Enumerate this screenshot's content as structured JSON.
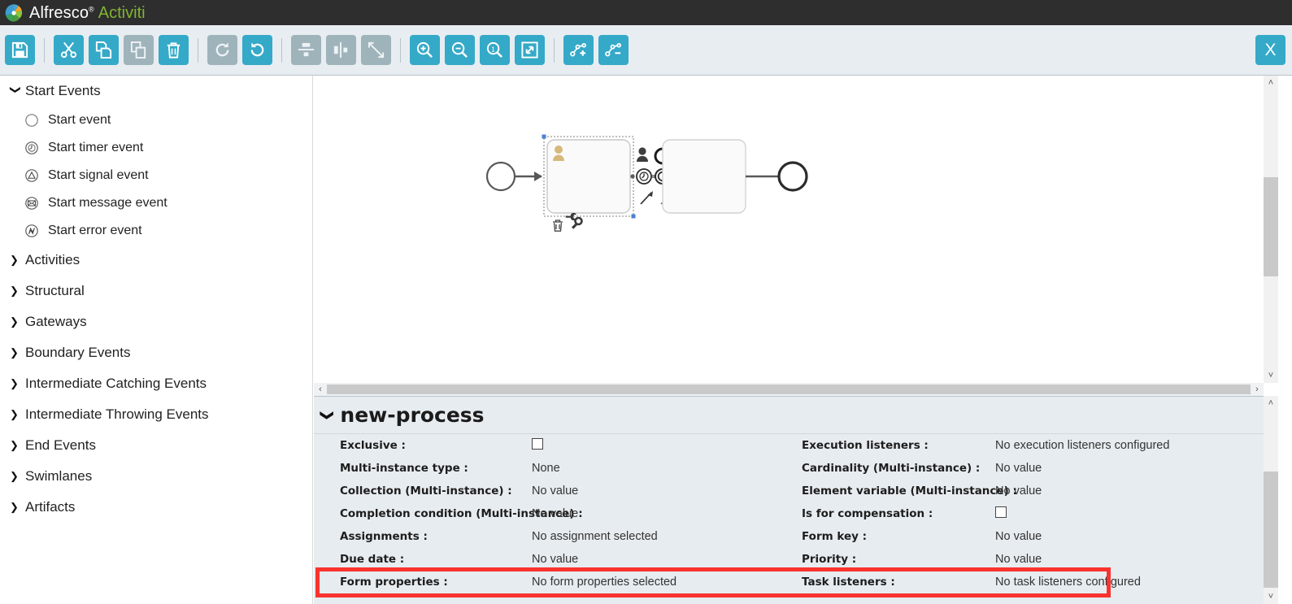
{
  "app": {
    "brand_primary": "Alfresco",
    "brand_reg": "®",
    "brand_secondary": "Activiti",
    "brand_accent": "#81b532",
    "header_bg": "#2e2e2e",
    "toolbar_accent": "#35a9c8",
    "toolbar_disabled": "#9fb3bb",
    "highlight_color": "#f9332e"
  },
  "toolbar": {
    "close_label": "X",
    "buttons": [
      {
        "name": "save",
        "icon": "floppy-disk-icon",
        "enabled": true
      },
      {
        "name": "cut",
        "icon": "scissors-icon",
        "enabled": true
      },
      {
        "name": "copy",
        "icon": "copy-pages-icon",
        "enabled": true
      },
      {
        "name": "paste",
        "icon": "paste-icon",
        "enabled": false
      },
      {
        "name": "delete",
        "icon": "trash-icon",
        "enabled": true
      },
      {
        "name": "redo",
        "icon": "redo-arrow-icon",
        "enabled": false
      },
      {
        "name": "undo",
        "icon": "undo-arrow-icon",
        "enabled": true
      },
      {
        "name": "align-vertical",
        "icon": "align-vertical-icon",
        "enabled": false
      },
      {
        "name": "align-horizontal",
        "icon": "align-horizontal-icon",
        "enabled": false
      },
      {
        "name": "same-size",
        "icon": "resize-same-size-icon",
        "enabled": false
      },
      {
        "name": "zoom-in",
        "icon": "magnifier-plus-icon",
        "enabled": true
      },
      {
        "name": "zoom-out",
        "icon": "magnifier-minus-icon",
        "enabled": true
      },
      {
        "name": "zoom-actual",
        "icon": "magnifier-one-icon",
        "enabled": true
      },
      {
        "name": "zoom-fit",
        "icon": "fit-to-screen-icon",
        "enabled": true
      },
      {
        "name": "add-bendpoint",
        "icon": "node-plus-icon",
        "enabled": true
      },
      {
        "name": "remove-bendpoint",
        "icon": "node-minus-icon",
        "enabled": true
      }
    ]
  },
  "palette": {
    "groups": [
      {
        "label": "Start Events",
        "expanded": true,
        "items": [
          {
            "label": "Start event",
            "icon": "circle-thin-icon"
          },
          {
            "label": "Start timer event",
            "icon": "clock-circle-icon"
          },
          {
            "label": "Start signal event",
            "icon": "triangle-circle-icon"
          },
          {
            "label": "Start message event",
            "icon": "envelope-circle-icon"
          },
          {
            "label": "Start error event",
            "icon": "error-bolt-circle-icon"
          }
        ]
      },
      {
        "label": "Activities",
        "expanded": false,
        "items": []
      },
      {
        "label": "Structural",
        "expanded": false,
        "items": []
      },
      {
        "label": "Gateways",
        "expanded": false,
        "items": []
      },
      {
        "label": "Boundary Events",
        "expanded": false,
        "items": []
      },
      {
        "label": "Intermediate Catching Events",
        "expanded": false,
        "items": []
      },
      {
        "label": "Intermediate Throwing Events",
        "expanded": false,
        "items": []
      },
      {
        "label": "End Events",
        "expanded": false,
        "items": []
      },
      {
        "label": "Swimlanes",
        "expanded": false,
        "items": []
      },
      {
        "label": "Artifacts",
        "expanded": false,
        "items": []
      }
    ]
  },
  "canvas": {
    "shapes": [
      {
        "name": "start-event",
        "type": "start-event"
      },
      {
        "name": "user-task-selected",
        "type": "user-task",
        "selected": true
      },
      {
        "name": "user-task-second",
        "type": "user-task",
        "selected": false
      },
      {
        "name": "end-event",
        "type": "end-event"
      }
    ],
    "quick_menu": [
      {
        "name": "morph-user-task-icon"
      },
      {
        "name": "morph-event-icon"
      },
      {
        "name": "morph-gateway-icon"
      },
      {
        "name": "morph-timer-icon"
      },
      {
        "name": "morph-end-event-icon"
      },
      {
        "name": "sequence-flow-icon"
      },
      {
        "name": "association-icon"
      }
    ],
    "context_actions": [
      {
        "name": "delete-shape-icon"
      },
      {
        "name": "edit-shape-icon"
      }
    ]
  },
  "properties": {
    "title": "new-process",
    "rows": [
      {
        "left": {
          "label": "Exclusive :",
          "value": "",
          "type": "checkbox",
          "checked": false
        },
        "right": {
          "label": "Execution listeners :",
          "value": "No execution listeners configured",
          "type": "text"
        }
      },
      {
        "left": {
          "label": "Multi-instance type :",
          "value": "None",
          "type": "text"
        },
        "right": {
          "label": "Cardinality (Multi-instance) :",
          "value": "No value",
          "type": "text"
        }
      },
      {
        "left": {
          "label": "Collection (Multi-instance) :",
          "value": "No value",
          "type": "text"
        },
        "right": {
          "label": "Element variable (Multi-instance) :",
          "value": "No value",
          "type": "text"
        }
      },
      {
        "left": {
          "label": "Completion condition (Multi-instance) :",
          "value": "No value",
          "type": "text"
        },
        "right": {
          "label": "Is for compensation :",
          "value": "",
          "type": "checkbox",
          "checked": false
        }
      },
      {
        "left": {
          "label": "Assignments :",
          "value": "No assignment selected",
          "type": "text"
        },
        "right": {
          "label": "Form key :",
          "value": "No value",
          "type": "text"
        },
        "highlighted": true
      },
      {
        "left": {
          "label": "Due date :",
          "value": "No value",
          "type": "text"
        },
        "right": {
          "label": "Priority :",
          "value": "No value",
          "type": "text"
        }
      },
      {
        "left": {
          "label": "Form properties :",
          "value": "No form properties selected",
          "type": "text"
        },
        "right": {
          "label": "Task listeners :",
          "value": "No task listeners configured",
          "type": "text"
        }
      }
    ]
  },
  "scrollbars": {
    "canvas_h_left_arrow": "‹",
    "canvas_h_right_arrow": "›",
    "up_arrow": "˄",
    "down_arrow": "˅"
  }
}
